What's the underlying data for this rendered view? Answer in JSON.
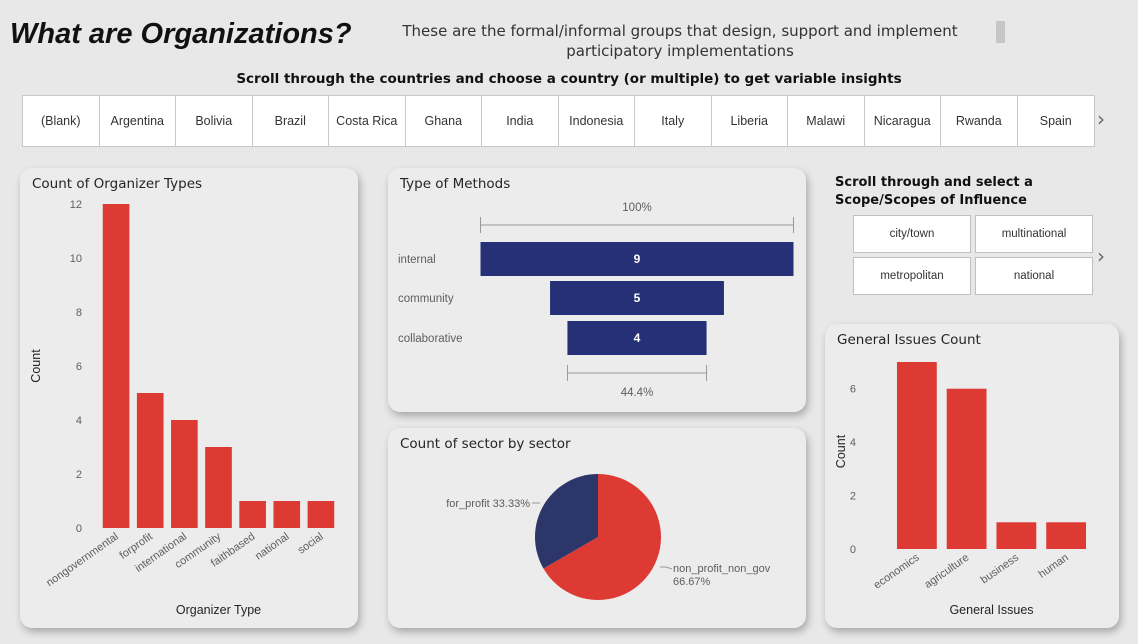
{
  "header": {
    "title": "What are Organizations?",
    "subtitle": "These are the formal/informal groups that design, support and implement participatory implementations"
  },
  "country_slicer": {
    "prompt": "Scroll through the countries and choose a country (or multiple) to get variable insights",
    "items": [
      "(Blank)",
      "Argentina",
      "Bolivia",
      "Brazil",
      "Costa Rica",
      "Ghana",
      "India",
      "Indonesia",
      "Italy",
      "Liberia",
      "Malawi",
      "Nicaragua",
      "Rwanda",
      "Spain"
    ],
    "next_icon": "chevron-right-icon"
  },
  "scope_slicer": {
    "title": "Scroll through and select a Scope/Scopes of Influence",
    "items": [
      "city/town",
      "multinational",
      "metropolitan",
      "national"
    ],
    "next_icon": "chevron-right-icon"
  },
  "colors": {
    "bar_red": "#dd3a33",
    "funnel_navy": "#263077",
    "pie_navy": "#2d3668",
    "background": "#e8e8e8"
  },
  "chart_data": [
    {
      "id": "organizer_types",
      "type": "bar",
      "title": "Count of Organizer Types",
      "xlabel": "Organizer Type",
      "ylabel": "Count",
      "categories": [
        "nongovernmental",
        "forprofit",
        "international",
        "community",
        "faithbased",
        "national",
        "social"
      ],
      "values": [
        12,
        5,
        4,
        3,
        1,
        1,
        1
      ],
      "ylim": [
        0,
        12
      ],
      "yticks": [
        "0",
        "2",
        "4",
        "6",
        "8",
        "10",
        "12"
      ],
      "grid": false
    },
    {
      "id": "methods",
      "type": "bar",
      "subtype": "funnel",
      "title": "Type of Methods",
      "categories": [
        "internal",
        "community",
        "collaborative"
      ],
      "values": [
        9,
        5,
        4
      ],
      "top_label": "100%",
      "bottom_label": "44.4%"
    },
    {
      "id": "sector",
      "type": "pie",
      "title": "Count of sector by sector",
      "slices": [
        {
          "label": "non_profit_non_gov",
          "value": 66.67,
          "display": "66.67%"
        },
        {
          "label": "for_profit",
          "value": 33.33,
          "display": "33.33%"
        }
      ]
    },
    {
      "id": "issues",
      "type": "bar",
      "title": "General Issues Count",
      "xlabel": "General Issues",
      "ylabel": "Count",
      "categories": [
        "economics",
        "agriculture",
        "business",
        "human"
      ],
      "values": [
        7,
        6,
        1,
        1
      ],
      "ylim": [
        0,
        7.3
      ],
      "yticks": [
        "0",
        "2",
        "4",
        "6"
      ],
      "grid": false
    }
  ]
}
